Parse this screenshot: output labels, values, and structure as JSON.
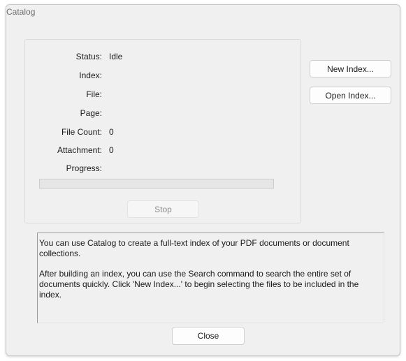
{
  "window": {
    "title": "Catalog"
  },
  "status_panel": {
    "fields": [
      {
        "label": "Status:",
        "value": "Idle"
      },
      {
        "label": "Index:",
        "value": ""
      },
      {
        "label": "File:",
        "value": ""
      },
      {
        "label": "Page:",
        "value": ""
      },
      {
        "label": "File Count:",
        "value": "0"
      },
      {
        "label": "Attachment:",
        "value": "0"
      },
      {
        "label": "Progress:",
        "value": ""
      }
    ],
    "progress_fraction": 0,
    "stop_label": "Stop"
  },
  "actions": {
    "new_index_label": "New Index...",
    "open_index_label": "Open Index..."
  },
  "info": {
    "paragraph1": "You can use Catalog to create a full-text index of your PDF documents or document collections.",
    "paragraph2": "After building an index, you can use the Search command to search the entire set of documents quickly.  Click 'New Index...' to begin selecting the files to be included in the index."
  },
  "footer": {
    "close_label": "Close"
  },
  "colors": {
    "accent": "#2f7bd6",
    "dialog_background": "#f0f0f0"
  }
}
